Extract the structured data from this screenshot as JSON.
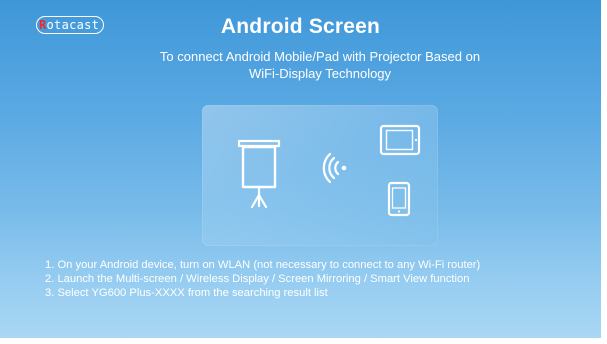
{
  "logo": {
    "initial": "R",
    "rest": "otacast"
  },
  "header": {
    "title": "Android Screen",
    "subtitle_line1": "To connect Android Mobile/Pad with Projector Based on",
    "subtitle_line2": "WiFi-Display Technology"
  },
  "illustration": {
    "icons": [
      "projector-screen-icon",
      "wifi-signal-icon",
      "tablet-icon",
      "phone-icon"
    ]
  },
  "instructions": [
    "1. On your Android device, turn on WLAN (not necessary to connect to any Wi-Fi router)",
    "2. Launch the Multi-screen / Wireless Display / Screen Mirroring / Smart View function",
    "3. Select YG600 Plus-XXXX from the searching result list"
  ],
  "colors": {
    "background_top": "#3f97d8",
    "background_bottom": "#a9d7f4",
    "logo_accent": "#ec2a2a",
    "text": "#ffffff"
  }
}
